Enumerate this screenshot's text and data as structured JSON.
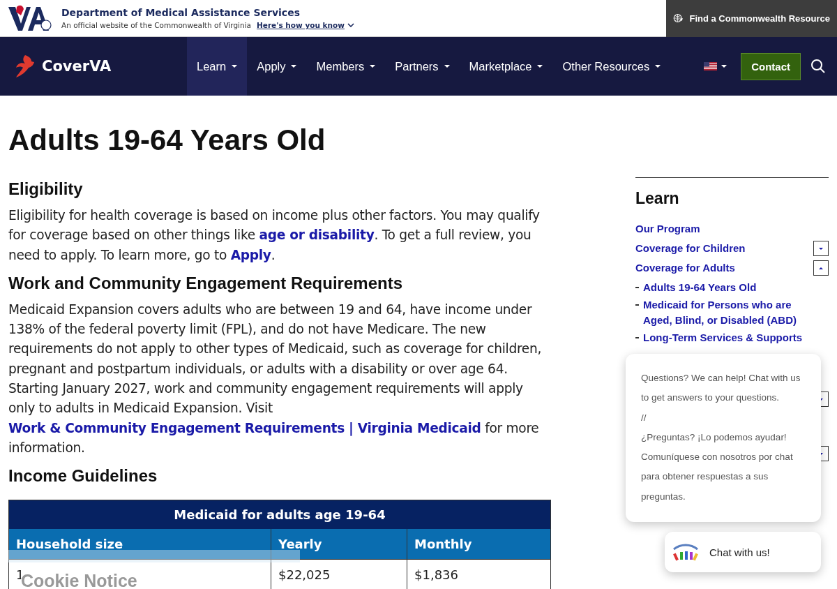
{
  "gov_banner": {
    "agency": "Department of Medical Assistance Services",
    "official_text": "An official website of the Commonwealth of Virginia",
    "how_link": "Here's how you know",
    "resource_button": "Find a Commonwealth Resource"
  },
  "nav": {
    "brand": "CoverVA",
    "items": [
      {
        "label": "Learn",
        "selected": true
      },
      {
        "label": "Apply",
        "selected": false
      },
      {
        "label": "Members",
        "selected": false
      },
      {
        "label": "Partners",
        "selected": false
      },
      {
        "label": "Marketplace",
        "selected": false
      },
      {
        "label": "Other Resources",
        "selected": false
      }
    ],
    "contact": "Contact"
  },
  "page_title": "Adults 19-64 Years Old",
  "sections": [
    {
      "heading": "Eligibility",
      "paragraph": [
        {
          "text": "Eligibility for health coverage is based on income plus other factors. You may qualify for coverage based on other things like "
        },
        {
          "link": "age or disability"
        },
        {
          "text": ". To get a full review, you need to apply. To learn more, go to "
        },
        {
          "link": "Apply"
        },
        {
          "text": "."
        }
      ]
    },
    {
      "heading": "Work and Community Engagement Requirements",
      "paragraph": [
        {
          "text": "Medicaid Expansion covers adults who are between 19 and 64, have income under 138% of the federal poverty limit (FPL), and do not have Medicare. The new requirements do not apply to other types of Medicaid, such as coverage for children, pregnant and postpartum individuals, or adults with a disability or over age 64. Starting January 2027, work and community engagement requirements will apply only to adults in Medicaid Expansion. Visit "
        },
        {
          "link": "Work & Community Engagement Requirements | Virginia Medicaid"
        },
        {
          "text": " for more information."
        }
      ]
    },
    {
      "heading": "Income Guidelines"
    }
  ],
  "table": {
    "title": "Medicaid for adults age 19-64",
    "columns": [
      "Household size",
      "Yearly",
      "Monthly"
    ],
    "rows": [
      [
        "1",
        "$22,025",
        "$1,836"
      ]
    ]
  },
  "sidebar": {
    "title": "Learn",
    "items": [
      {
        "label": "Our Program"
      },
      {
        "label": "Coverage for Children",
        "expanded": false
      },
      {
        "label": "Coverage for Adults",
        "expanded": true,
        "children": [
          {
            "label": "Adults 19-64 Years Old"
          },
          {
            "label": "Medicaid for Persons who are Aged, Blind, or Disabled (ABD)"
          },
          {
            "label": "Long-Term Services & Supports"
          }
        ]
      }
    ],
    "hidden_toggles": [
      {
        "expanded": false
      },
      {
        "expanded": false
      }
    ]
  },
  "chat": {
    "message": [
      "Questions? We can help! Chat with us to get answers to your questions.",
      "//",
      "¿Preguntas? ¡Lo podemos ayudar! Comuníquese con nosotros por chat para obtener respuestas a sus preguntas."
    ],
    "button": "Chat with us!"
  },
  "cookie_notice": {
    "title": "Cookie Notice"
  }
}
